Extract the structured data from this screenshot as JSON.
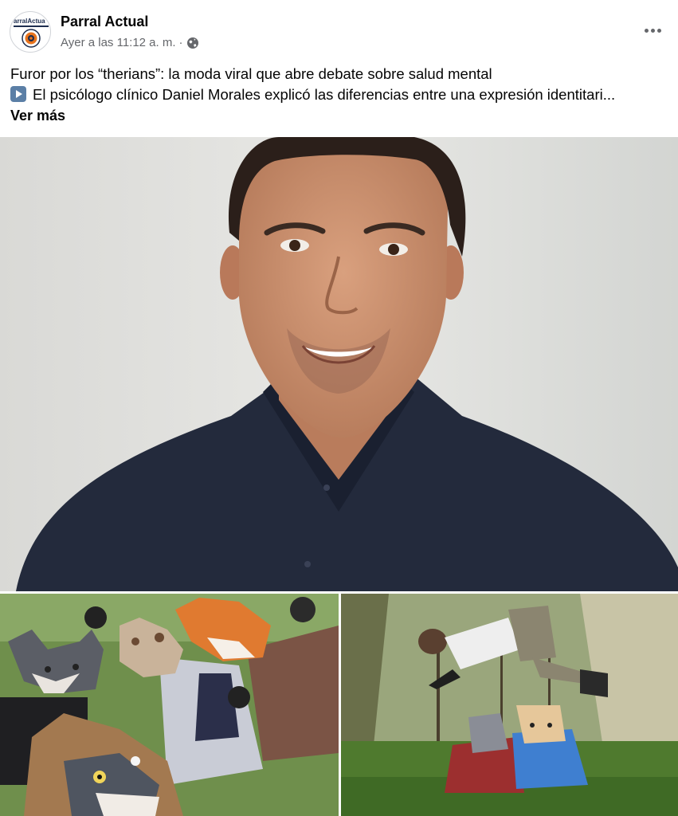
{
  "post": {
    "page_name": "Parral Actual",
    "timestamp": "Ayer a las 11:12 a. m.",
    "separator": "·",
    "privacy_icon": "globe-icon",
    "more_icon": "more-dots-icon",
    "headline": "Furor por los “therians”: la moda viral que abre debate sobre salud mental",
    "body_icon": "play-button-icon",
    "body": "El psicólogo clínico Daniel Morales explicó las diferencias entre una expresión identitari...",
    "see_more": "Ver más"
  },
  "avatar": {
    "logo_text": "arralActua"
  },
  "colors": {
    "meta_gray": "#65676b",
    "text": "#050505",
    "play_icon_bg": "#5b7fa6",
    "logo_orange": "#e8731d"
  }
}
